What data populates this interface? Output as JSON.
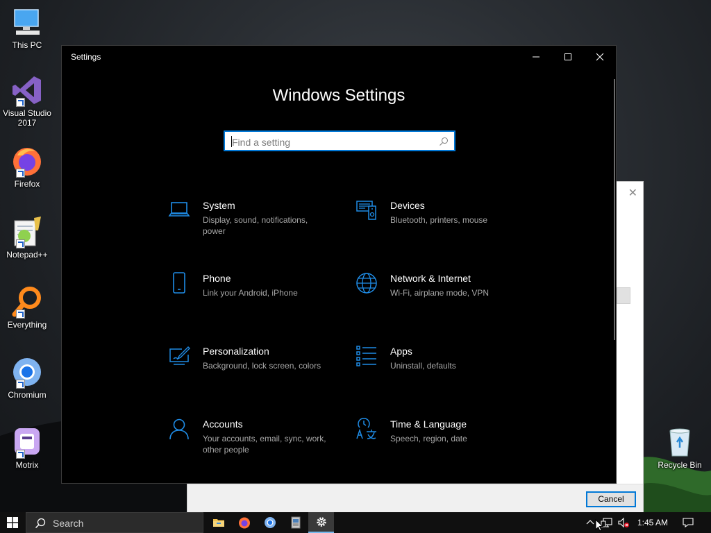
{
  "desktop": {
    "icons": [
      {
        "label": "This PC"
      },
      {
        "label": "Visual Studio 2017"
      },
      {
        "label": "Firefox"
      },
      {
        "label": "Notepad++"
      },
      {
        "label": "Everything"
      },
      {
        "label": "Chromium"
      },
      {
        "label": "Motrix"
      },
      {
        "label": "Recycle Bin"
      }
    ]
  },
  "background_dialog": {
    "close_glyph": "✕",
    "cancel_label": "Cancel"
  },
  "settings": {
    "window_title": "Settings",
    "heading": "Windows Settings",
    "search_placeholder": "Find a setting",
    "accent": "#0078d7",
    "tiles": [
      {
        "name": "System",
        "desc": "Display, sound, notifications, power",
        "icon": "laptop-icon"
      },
      {
        "name": "Devices",
        "desc": "Bluetooth, printers, mouse",
        "icon": "devices-icon"
      },
      {
        "name": "Phone",
        "desc": "Link your Android, iPhone",
        "icon": "phone-icon"
      },
      {
        "name": "Network & Internet",
        "desc": "Wi-Fi, airplane mode, VPN",
        "icon": "globe-icon"
      },
      {
        "name": "Personalization",
        "desc": "Background, lock screen, colors",
        "icon": "personalization-icon"
      },
      {
        "name": "Apps",
        "desc": "Uninstall, defaults",
        "icon": "apps-list-icon"
      },
      {
        "name": "Accounts",
        "desc": "Your accounts, email, sync, work, other people",
        "icon": "person-icon"
      },
      {
        "name": "Time & Language",
        "desc": "Speech, region, date",
        "icon": "time-language-icon"
      }
    ]
  },
  "taskbar": {
    "search_label": "Search",
    "clock": "1:45 AM"
  }
}
